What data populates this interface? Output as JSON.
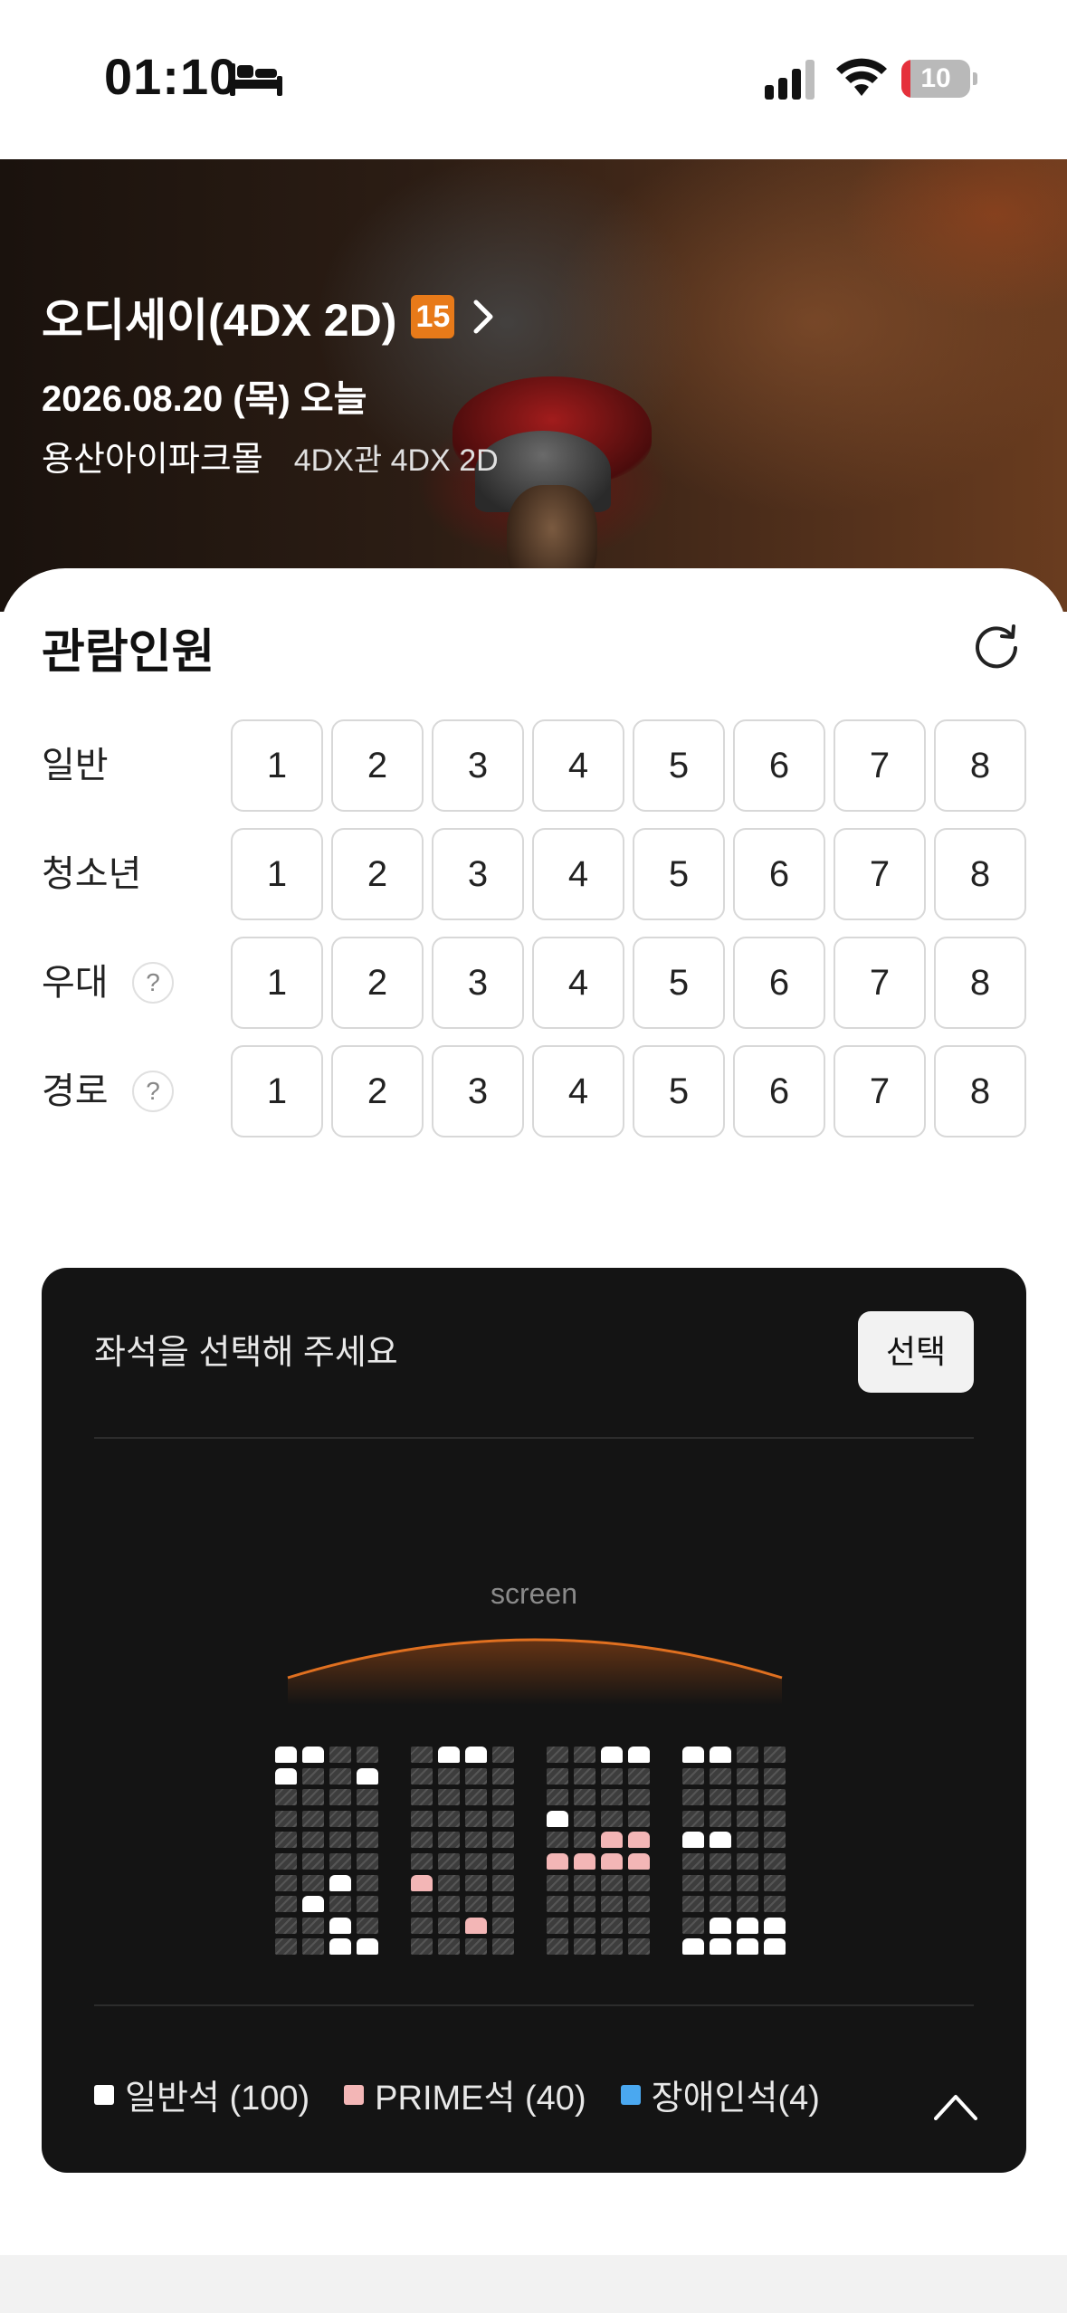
{
  "status_bar": {
    "time": "01:10",
    "battery_level": "10",
    "battery_color": "#e5303b"
  },
  "movie": {
    "title": "오디세이(4DX 2D)",
    "age_rating": "15",
    "date": "2026.08.20 (목) 오늘",
    "theater": "용산아이파크몰",
    "hall": "4DX관 4DX 2D"
  },
  "audience": {
    "title": "관람인원",
    "rows": [
      {
        "label": "일반",
        "help": false
      },
      {
        "label": "청소년",
        "help": false
      },
      {
        "label": "우대",
        "help": true
      },
      {
        "label": "경로",
        "help": true
      }
    ],
    "counts": [
      "1",
      "2",
      "3",
      "4",
      "5",
      "6",
      "7",
      "8"
    ],
    "help_mark": "?"
  },
  "seat_panel": {
    "prompt": "좌석을 선택해 주세요",
    "select_label": "선택",
    "screen_label": "screen",
    "legend": [
      {
        "label": "일반석 (100)",
        "color": "#ffffff"
      },
      {
        "label": "PRIME석 (40)",
        "color": "#f3b6b6"
      },
      {
        "label": "장애인석(4)",
        "color": "#4aa8f0"
      }
    ],
    "seat_map": {
      "legend_codes": {
        "X": "occupied",
        "W": "general",
        "P": "prime",
        "B": "disabled"
      },
      "blocks": [
        [
          "WWXX",
          "WXXW",
          "XXXX",
          "XXXX",
          "XXXX",
          "XXXX",
          "XXWX",
          "XWXX",
          "XXWX",
          "XXWW"
        ],
        [
          "XWWX",
          "XXXX",
          "XXXX",
          "XXXX",
          "XXXX",
          "XXXX",
          "PXXX",
          "XXXX",
          "XXPX",
          "XXXX"
        ],
        [
          "XXWW",
          "XXXX",
          "XXXX",
          "WXXX",
          "XXPP",
          "PPPP",
          "XXXX",
          "XXXX",
          "XXXX",
          "XXXX"
        ],
        [
          "WWXX",
          "XXXX",
          "XXXX",
          "XXXX",
          "WWXX",
          "XXXX",
          "XXXX",
          "XXXX",
          "XWWW",
          "WWWW"
        ]
      ]
    }
  }
}
